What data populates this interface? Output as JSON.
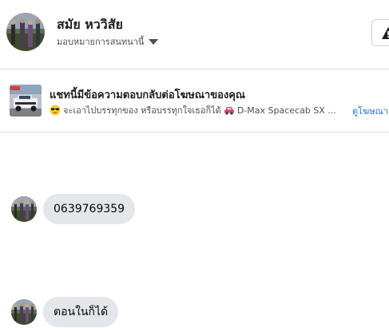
{
  "header": {
    "contact_name": "สมัย หววิสัย",
    "assign_label": "มอบหมายการสนทนานี้",
    "avatar_icon": "profile-photo-icon",
    "caret_icon": "caret-down-icon",
    "action_icon": "alert-icon"
  },
  "ad_reply": {
    "title": "แชทนี้มีข้อความตอบกลับต่อโฆษณาของคุณ",
    "emoji_icon": "sunglasses-emoji-icon",
    "text_1": "จะเอาไปบรรทุกของ หรือบรรทุกใจเธอก็ได้",
    "car_icon": "car-emoji-icon",
    "text_2": "D-Max Spacecab SX ...",
    "link": "ดูโฆษณา",
    "thumbnail_icon": "pickup-truck-photo-icon"
  },
  "messages": [
    {
      "text": "0639769359"
    },
    {
      "text": "ตอนในก็ได้"
    }
  ],
  "colors": {
    "bubble": "#e4e6eb",
    "link": "#216fdb",
    "divider": "#dadde1"
  }
}
